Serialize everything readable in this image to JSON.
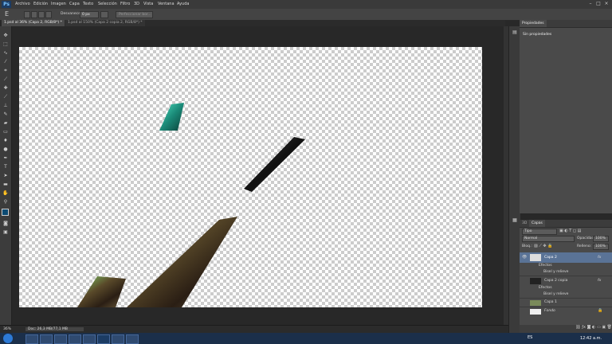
{
  "app": {
    "logo": "Ps"
  },
  "menu": {
    "items": [
      "Archivo",
      "Edición",
      "Imagen",
      "Capa",
      "Texto",
      "Selección",
      "Filtro",
      "3D",
      "Vista",
      "Ventana",
      "Ayuda"
    ]
  },
  "window_controls": {
    "minimize": "–",
    "maximize": "□",
    "close": "×"
  },
  "options_bar": {
    "difuminar_label": "Desvanecer:",
    "difuminar_value": "0 px",
    "refine_button": "Perfeccionar bor..."
  },
  "tabs": [
    {
      "label": "1.psd al 36% (Capa 2, RGB/8*) *",
      "active": true
    },
    {
      "label": "1.psd al 150% (Capa 2 copia 2, RGB/8*) *",
      "active": false
    }
  ],
  "status": {
    "zoom": "36%",
    "doc_size": "Doc: 26,3 MB/77,1 MB"
  },
  "properties_panel": {
    "tab": "Propiedades",
    "message": "Sin propiedades"
  },
  "layers_panel": {
    "tabs": [
      "3D",
      "Capas"
    ],
    "filter": "Tipo",
    "blend_mode": "Normal",
    "opacity_label": "Opacidad:",
    "opacity_value": "100%",
    "lock_label": "Bloq.:",
    "fill_label": "Relleno:",
    "fill_value": "100%",
    "layers": [
      {
        "name": "Capa 2",
        "fx": "fx",
        "selected": true
      },
      {
        "name": "Efectos",
        "sub": true
      },
      {
        "name": "Bisel y relieve",
        "sub": true
      },
      {
        "name": "Capa 2 copia",
        "fx": "fx",
        "selected": false
      },
      {
        "name": "Efectos",
        "sub": true
      },
      {
        "name": "Bisel y relieve",
        "sub": true
      },
      {
        "name": "Capa 1",
        "selected": false
      },
      {
        "name": "Fondo",
        "selected": false
      }
    ]
  },
  "taskbar": {
    "lang": "ES",
    "time": "12:42 a.m."
  },
  "colors": {
    "accent": "#1e6fd9",
    "selected_layer": "#5a7396",
    "canvas_bg": "#282828"
  }
}
